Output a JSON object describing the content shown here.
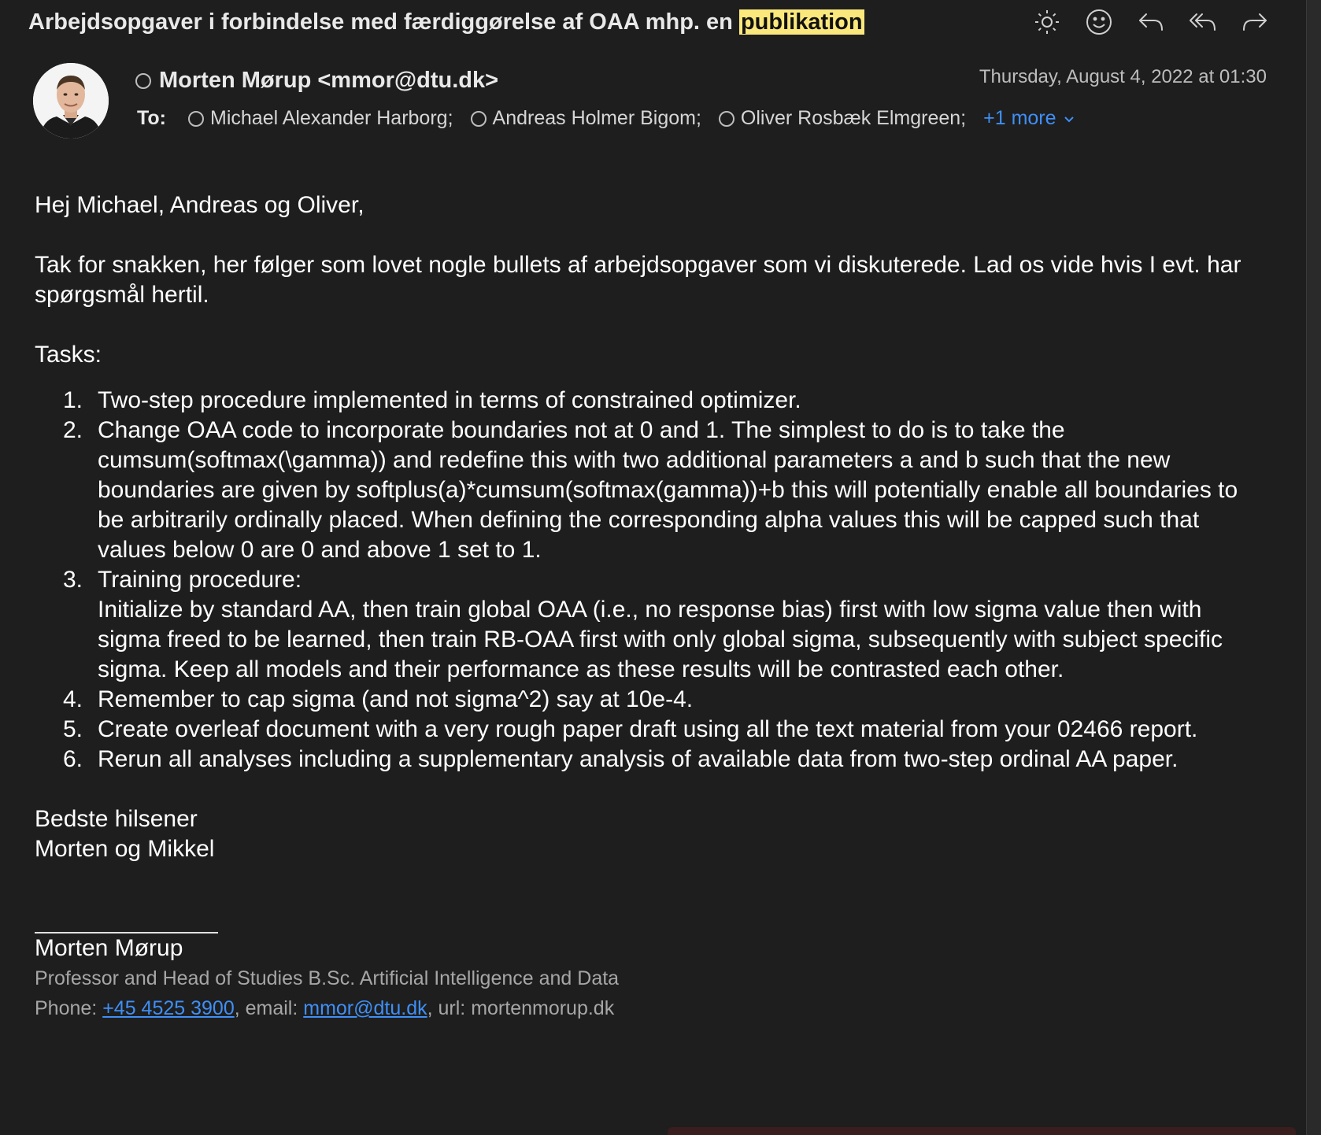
{
  "subject": {
    "text": "Arbejdsopgaver i forbindelse med færdiggørelse af OAA mhp. en",
    "highlight": "publikation"
  },
  "toolbar": {
    "icons": [
      "sun-icon",
      "smiley-icon",
      "reply-icon",
      "reply-all-icon",
      "forward-icon"
    ]
  },
  "header": {
    "from": "Morten Mørup <mmor@dtu.dk>",
    "date": "Thursday, August 4, 2022 at 01:30",
    "to_label": "To:",
    "recipients": [
      "Michael Alexander Harborg;",
      "Andreas Holmer Bigom;",
      "Oliver Rosbæk Elmgreen;"
    ],
    "more": "+1 more"
  },
  "body": {
    "greeting": "Hej Michael, Andreas og Oliver,",
    "intro": "Tak for snakken, her følger som lovet nogle bullets af arbejdsopgaver som vi diskuterede. Lad os vide hvis I evt. har spørgsmål hertil.",
    "tasks_label": "Tasks:",
    "tasks": [
      {
        "num": "1.",
        "text": "Two-step procedure implemented in terms of constrained optimizer."
      },
      {
        "num": "2.",
        "text": "Change OAA code to incorporate boundaries not at 0 and 1. The simplest to do is to take the cumsum(softmax(\\gamma)) and redefine this with two additional parameters a and b such that the new boundaries are given by softplus(a)*cumsum(softmax(gamma))+b this will potentially enable all boundaries to be arbitrarily ordinally placed. When defining the corresponding alpha values this will be capped such that values below 0 are 0 and above 1 set to 1."
      },
      {
        "num": "3.",
        "text": "Training procedure:",
        "subtext": "Initialize by standard AA, then train global OAA (i.e., no response bias) first with low sigma value then with sigma freed to be learned, then train RB-OAA first with only global sigma, subsequently with subject specific sigma. Keep all models and their performance as these results will be contrasted each other."
      },
      {
        "num": "4.",
        "text": "Remember to cap sigma (and not sigma^2) say at 10e-4."
      },
      {
        "num": "5.",
        "text": "Create overleaf document with a very rough paper draft using all the text material from your 02466 report."
      },
      {
        "num": "6.",
        "text": "Rerun all analyses including a supplementary analysis of available data from two-step ordinal AA paper."
      }
    ],
    "closing1": "Bedste hilsener",
    "closing2": "Morten og Mikkel"
  },
  "signature": {
    "name": "Morten Mørup",
    "title": "Professor and Head of Studies B.Sc. Artificial Intelligence and Data",
    "phone_label": "Phone: ",
    "phone": "+45 4525 3900",
    "email_label": ", email: ",
    "email": "mmor@dtu.dk",
    "url_label": ", url: mortenmorup.dk"
  },
  "colors": {
    "background": "#1e1e1e",
    "highlight": "#fbe87c",
    "link": "#3f8ff7"
  }
}
